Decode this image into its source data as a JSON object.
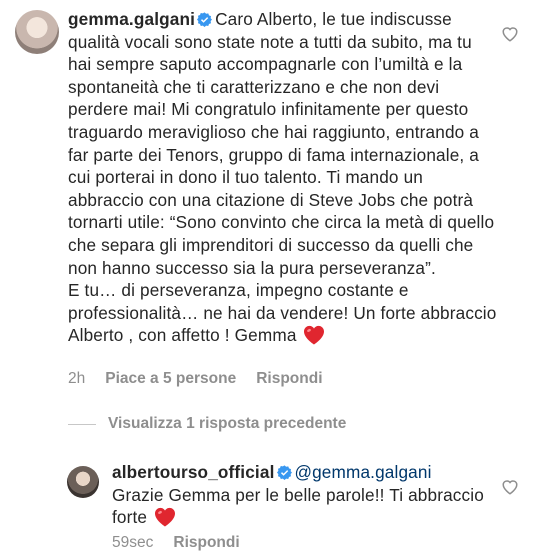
{
  "comment": {
    "username": "gemma.galgani",
    "text": "Caro Alberto, le tue indiscusse qualità vocali sono state note a tutti da subito, ma tu hai sempre saputo accompagnarle con l’umiltà e la spontaneità che ti caratterizzano e che non devi perdere mai! Mi congratulo infinitamente per questo traguardo meraviglioso che hai raggiunto, entrando a far parte dei Tenors, gruppo di fama internazionale, a cui porterai in dono il tuo talento. Ti mando un abbraccio con una citazione di Steve Jobs che potrà tornarti utile: “Sono convinto che circa la metà di quello che separa gli imprenditori di successo da quelli che non hanno successo sia la pura perseveranza”.",
    "text2": "E tu… di perseveranza, impegno costante e professionalità… ne hai da vendere! Un forte abbraccio Alberto , con affetto ! Gemma",
    "time": "2h",
    "likes": "Piace a 5 persone",
    "reply_label": "Rispondi"
  },
  "view_replies_label": "Visualizza 1 risposta precedente",
  "reply": {
    "username": "albertourso_official",
    "mention": "@gemma.galgani",
    "text": "Grazie Gemma per le belle parole!! Ti abbraccio forte",
    "time": "59sec",
    "reply_label": "Rispondi"
  },
  "colors": {
    "verified": "#3897f0",
    "heart": "#e0262f",
    "meta": "#8e8e8e",
    "mention": "#00376b"
  },
  "icons": [
    "verified-badge-icon",
    "heart-emoji-icon",
    "like-heart-icon"
  ]
}
